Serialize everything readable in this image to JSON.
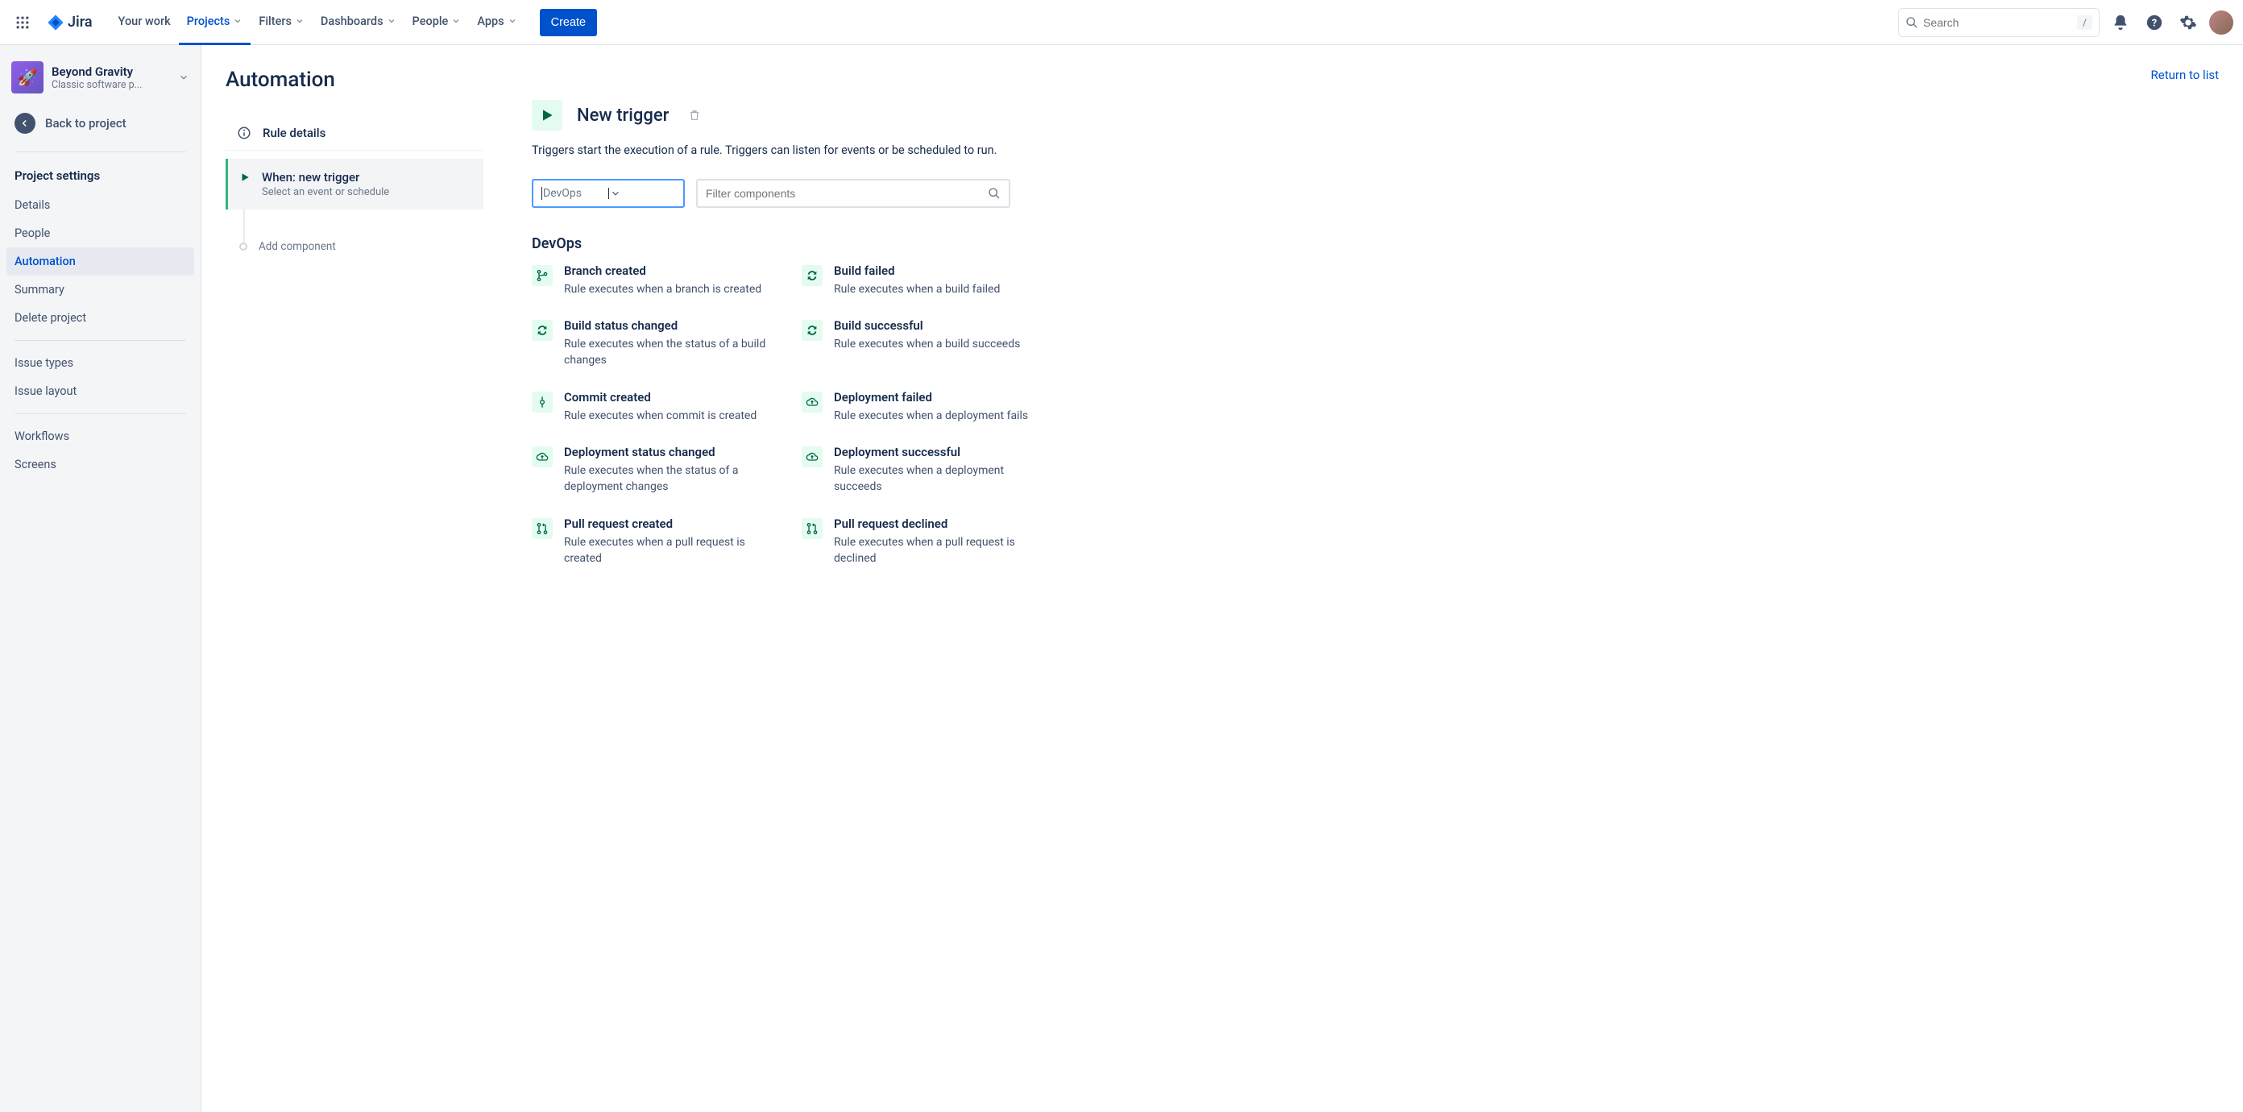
{
  "topnav": {
    "product": "Jira",
    "items": [
      "Your work",
      "Projects",
      "Filters",
      "Dashboards",
      "People",
      "Apps"
    ],
    "active_index": 1,
    "create_label": "Create",
    "search_placeholder": "Search",
    "search_kbd": "/"
  },
  "sidebar": {
    "project_name": "Beyond Gravity",
    "project_subtitle": "Classic software p...",
    "back_label": "Back to project",
    "settings_heading": "Project settings",
    "items1": [
      "Details",
      "People",
      "Automation",
      "Summary",
      "Delete project"
    ],
    "active1_index": 2,
    "items2": [
      "Issue types",
      "Issue layout"
    ],
    "items3": [
      "Workflows",
      "Screens"
    ]
  },
  "middle": {
    "page_title": "Automation",
    "rule_details_label": "Rule details",
    "trigger_title": "When: new trigger",
    "trigger_sub": "Select an event or schedule",
    "add_component_label": "Add component"
  },
  "main": {
    "return_link": "Return to list",
    "panel_title": "New trigger",
    "panel_desc": "Triggers start the execution of a rule. Triggers can listen for events or be scheduled to run.",
    "category_select_value": "DevOps",
    "filter_placeholder": "Filter components",
    "section_title": "DevOps",
    "triggers": [
      {
        "title": "Branch created",
        "desc": "Rule executes when a branch is created",
        "icon": "branch"
      },
      {
        "title": "Build failed",
        "desc": "Rule executes when a build failed",
        "icon": "cycle"
      },
      {
        "title": "Build status changed",
        "desc": "Rule executes when the status of a build changes",
        "icon": "cycle"
      },
      {
        "title": "Build successful",
        "desc": "Rule executes when a build succeeds",
        "icon": "cycle"
      },
      {
        "title": "Commit created",
        "desc": "Rule executes when commit is created",
        "icon": "commit"
      },
      {
        "title": "Deployment failed",
        "desc": "Rule executes when a deployment fails",
        "icon": "cloud"
      },
      {
        "title": "Deployment status changed",
        "desc": "Rule executes when the status of a deployment changes",
        "icon": "cloud"
      },
      {
        "title": "Deployment successful",
        "desc": "Rule executes when a deployment succeeds",
        "icon": "cloud"
      },
      {
        "title": "Pull request created",
        "desc": "Rule executes when a pull request is created",
        "icon": "pr"
      },
      {
        "title": "Pull request declined",
        "desc": "Rule executes when a pull request is declined",
        "icon": "pr"
      }
    ]
  }
}
